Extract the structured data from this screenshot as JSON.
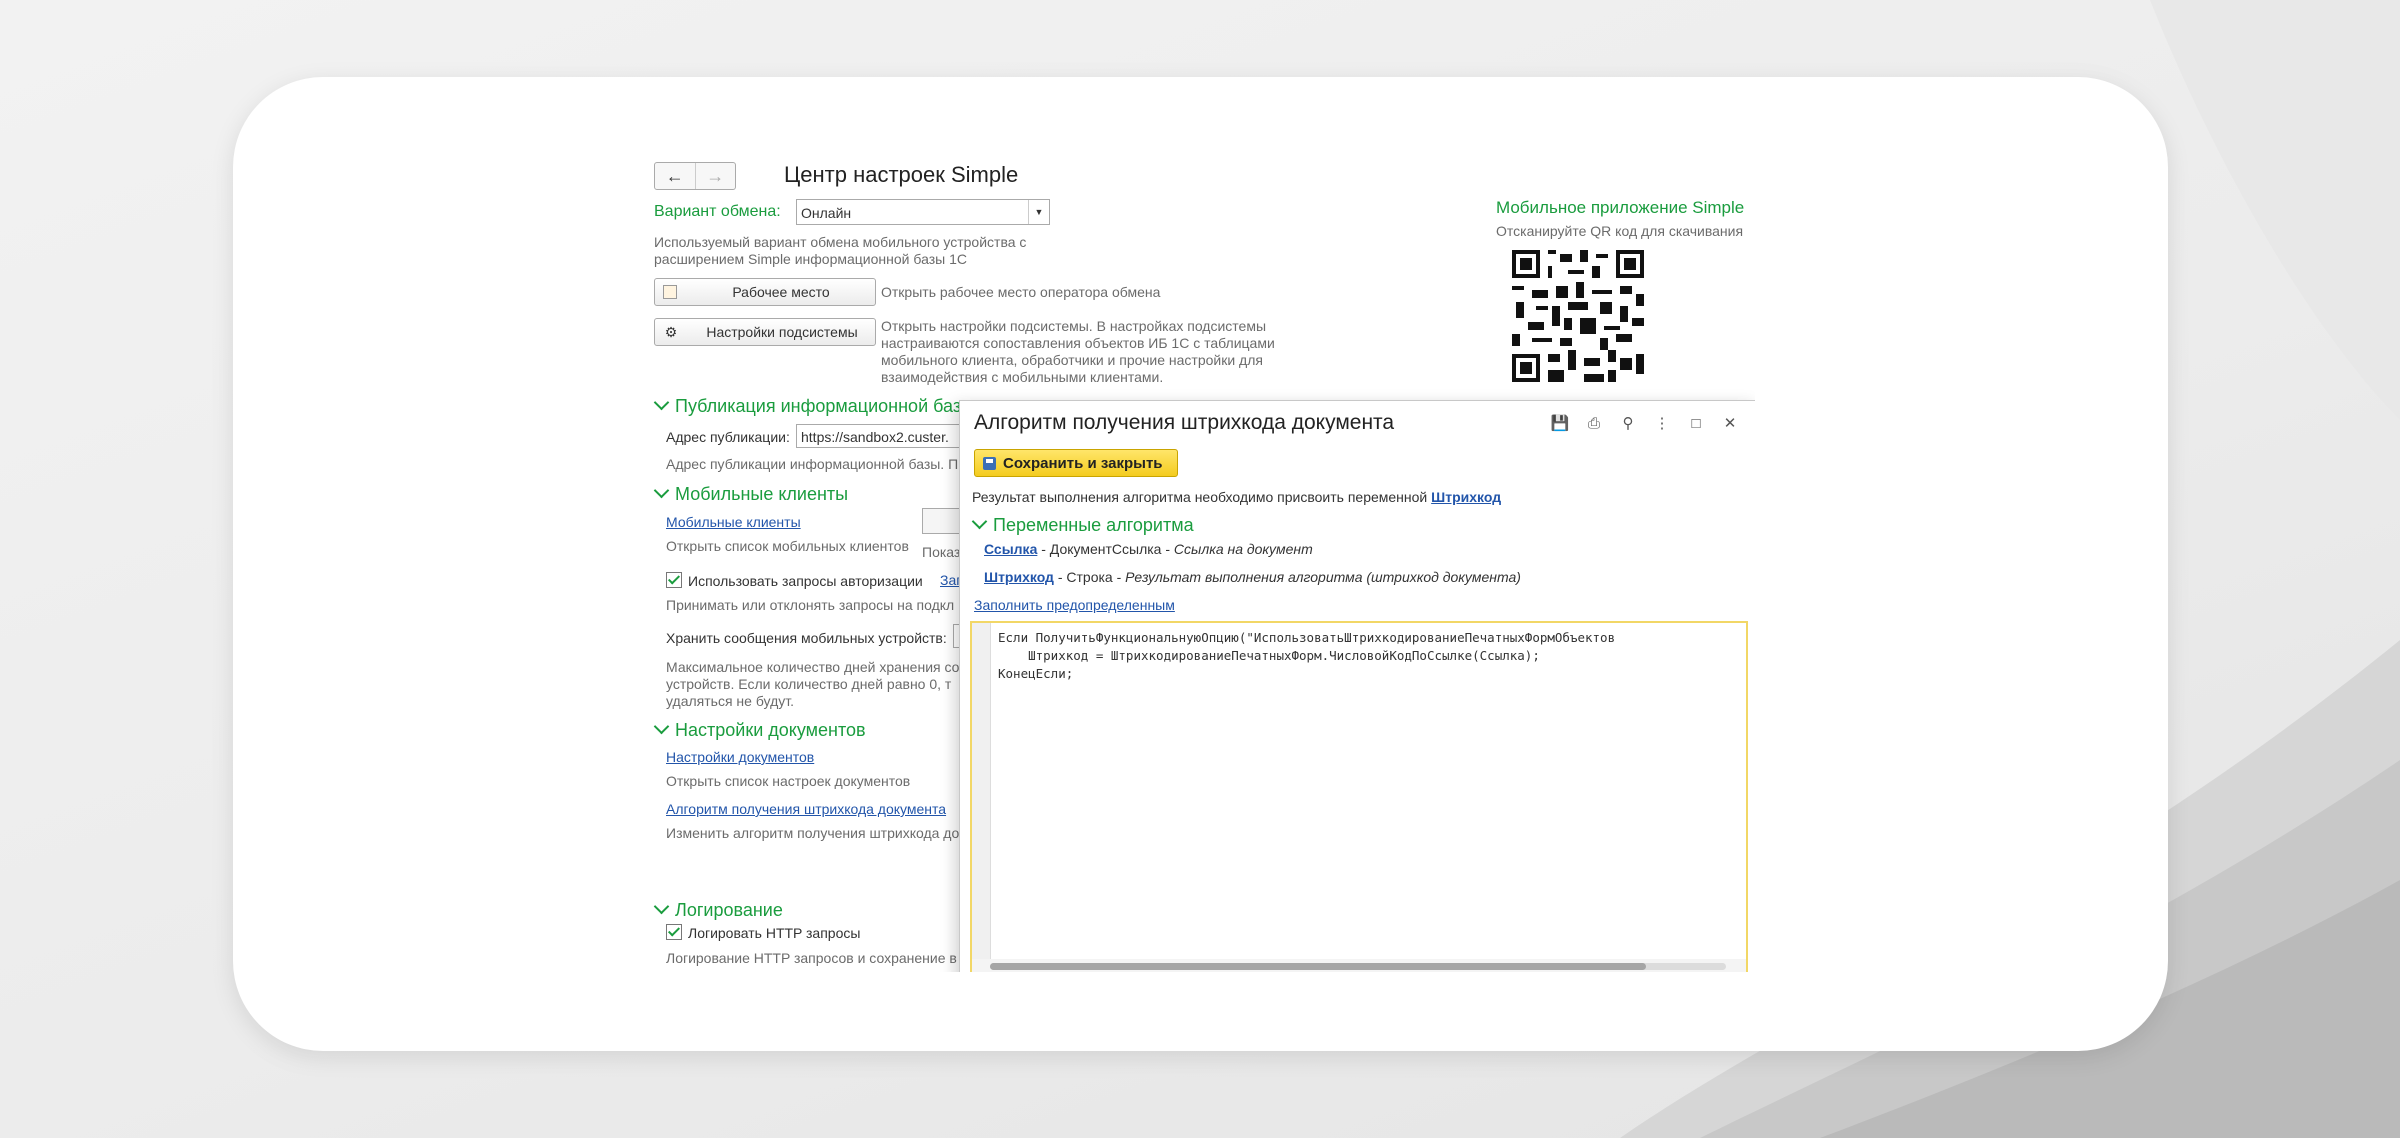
{
  "window": {
    "title": "Центр настроек Simple"
  },
  "exchange": {
    "label": "Вариант обмена:",
    "value": "Онлайн",
    "hint_line1": "Используемый вариант обмена мобильного устройства с",
    "hint_line2": "расширением Simple информационной базы 1С"
  },
  "workplace": {
    "label": "Рабочее место",
    "hint": "Открыть рабочее место оператора обмена"
  },
  "subsystem": {
    "label": "Настройки подсистемы",
    "hint_lines": [
      "Открыть настройки подсистемы. В настройках подсистемы",
      "настраиваются сопоставления объектов ИБ 1С с таблицами",
      "мобильного клиента, обработчики и прочие настройки для",
      "взаимодействия с мобильными клиентами."
    ]
  },
  "mobile_app": {
    "title": "Мобильное приложение Simple",
    "hint": "Отсканируйте QR код для скачивания"
  },
  "publication": {
    "section": "Публикация информационной базы",
    "address_label": "Адрес публикации:",
    "address_value": "https://sandbox2.custer.",
    "hint": "Адрес публикации информационной базы. П"
  },
  "mobile_clients": {
    "section": "Мобильные клиенты",
    "link": "Мобильные клиенты",
    "hint": "Открыть список мобильных клиентов",
    "side_hint": "Показ",
    "auth_checkbox": "Использовать запросы авторизации",
    "auth_link": "Зап",
    "auth_hint": "Принимать или отклонять запросы на подкл",
    "store_label": "Хранить сообщения мобильных устройств:",
    "store_hint_lines": [
      "Максимальное количество дней хранения со",
      "устройств. Если количество дней равно 0, т",
      "удаляться не будут."
    ]
  },
  "documents": {
    "section": "Настройки документов",
    "link": "Настройки документов",
    "hint": "Открыть список настроек документов",
    "barcode_link": "Алгоритм получения штрихкода документа",
    "barcode_hint": "Изменить алгоритм получения штрихкода до"
  },
  "logging": {
    "section": "Логирование",
    "checkbox": "Логировать HTTP запросы",
    "hint": "Логирование HTTP запросов и сохранение в"
  },
  "dialog": {
    "title": "Алгоритм получения штрихкода документа",
    "save_close": "Сохранить и закрыть",
    "result_text": "Результат выполнения алгоритма необходимо присвоить переменной",
    "result_var": "Штрихкод",
    "variables_section": "Переменные алгоритма",
    "var1_name": "Ссылка",
    "var1_type": " - ДокументСсылка - ",
    "var1_desc": "Ссылка на документ",
    "var2_name": "Штрихкод",
    "var2_type": " - Строка - ",
    "var2_desc": "Результат выполнения алгоритма (штрихкод документа)",
    "fill_link": "Заполнить предопределенным",
    "code_lines": [
      "Если ПолучитьФункциональнуюОпцию(\"ИспользоватьШтрихкодированиеПечатныхФормОбъектов",
      "    Штрихкод = ШтрихкодированиеПечатныхФорм.ЧисловойКодПоСсылке(Ссылка);",
      "КонецЕсли;"
    ]
  },
  "icons": [
    "back-arrow-icon",
    "forward-arrow-icon",
    "workplace-icon",
    "gear-icon",
    "chevron-down-icon",
    "save-icon",
    "print-icon",
    "preview-icon",
    "more-icon",
    "maximize-icon",
    "close-icon",
    "checkbox-icon",
    "qr-code-icon"
  ],
  "colors": {
    "accent": "#1a9c3e",
    "link": "#2255aa",
    "save_button": "#f4cc1f"
  }
}
